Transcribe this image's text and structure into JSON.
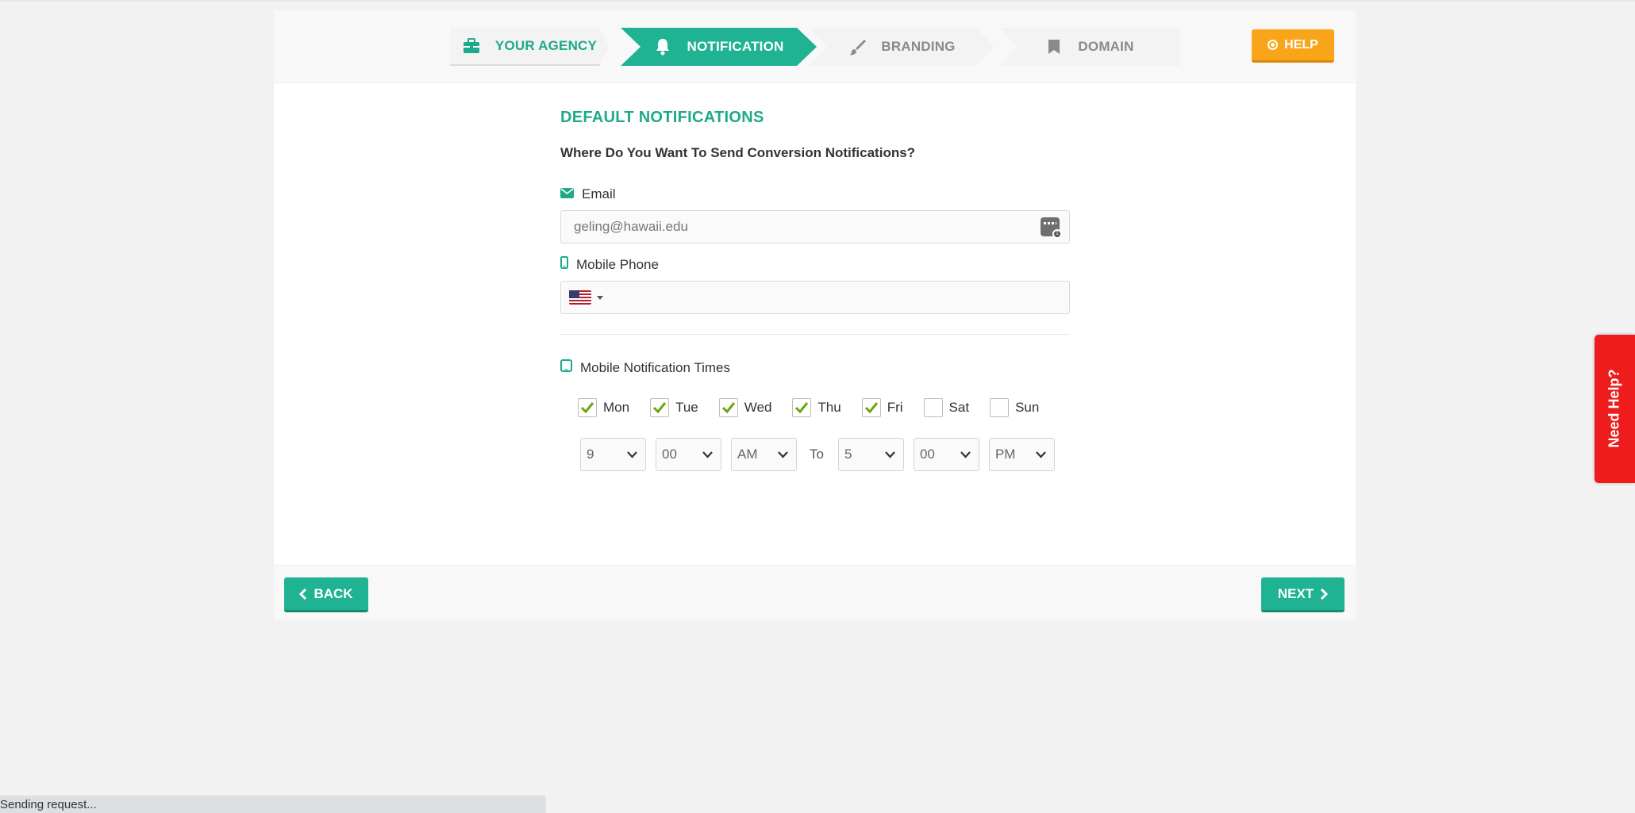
{
  "steps": [
    {
      "label": "YOUR AGENCY",
      "icon": "briefcase-icon",
      "state": "done"
    },
    {
      "label": "NOTIFICATION",
      "icon": "bell-icon",
      "state": "active"
    },
    {
      "label": "BRANDING",
      "icon": "brush-icon",
      "state": "pending"
    },
    {
      "label": "DOMAIN",
      "icon": "bookmark-icon",
      "state": "pending"
    }
  ],
  "help_button": {
    "label": "HELP",
    "icon": "help-circle-icon"
  },
  "form": {
    "section_title": "DEFAULT NOTIFICATIONS",
    "question": "Where Do You Want To Send Conversion Notifications?",
    "email": {
      "label": "Email",
      "icon": "envelope-icon",
      "value": "geling@hawaii.edu"
    },
    "phone": {
      "label": "Mobile Phone",
      "icon": "mobile-icon",
      "value": "",
      "country_flag": "us-flag-icon"
    },
    "times": {
      "label": "Mobile Notification Times",
      "icon": "tablet-icon",
      "days": [
        {
          "label": "Mon",
          "checked": true
        },
        {
          "label": "Tue",
          "checked": true
        },
        {
          "label": "Wed",
          "checked": true
        },
        {
          "label": "Thu",
          "checked": true
        },
        {
          "label": "Fri",
          "checked": true
        },
        {
          "label": "Sat",
          "checked": false
        },
        {
          "label": "Sun",
          "checked": false
        }
      ],
      "from": {
        "hour": "9",
        "minute": "00",
        "ampm": "AM"
      },
      "to_label": "To",
      "to": {
        "hour": "5",
        "minute": "00",
        "ampm": "PM"
      }
    }
  },
  "footer": {
    "back_label": "BACK",
    "next_label": "NEXT"
  },
  "side_tab": {
    "label": "Need Help?"
  },
  "status_bar": {
    "text": "Sending request..."
  },
  "colors": {
    "accent": "#1fb394",
    "accent_text": "#1fa98a",
    "help": "#f9a51a",
    "need_help": "#ee1c1c",
    "check": "#6aa60f"
  }
}
